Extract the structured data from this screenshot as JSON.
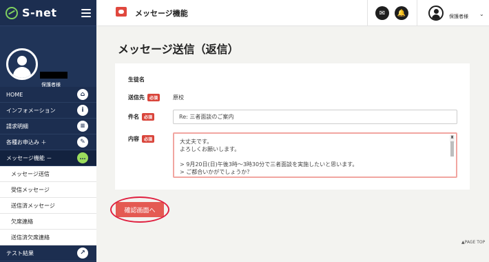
{
  "app": {
    "logo": "S-net"
  },
  "profile": {
    "name": "保護者様"
  },
  "nav": {
    "items": [
      {
        "label": "HOME",
        "icon": "home-icon",
        "glyph": "⌂"
      },
      {
        "label": "インフォメーション",
        "icon": "info-icon",
        "glyph": "i"
      },
      {
        "label": "請求明細",
        "icon": "document-icon",
        "glyph": "≡"
      },
      {
        "label": "各種お申込み ＋",
        "icon": "edit-icon",
        "glyph": "✎"
      },
      {
        "label": "メッセージ機能 －",
        "icon": "chat-icon",
        "glyph": "…"
      }
    ],
    "sub_items": [
      "メッセージ送信",
      "受信メッセージ",
      "送信済メッセージ",
      "欠席連絡",
      "送信済欠席連絡"
    ],
    "last_item": {
      "label": "テスト結果",
      "icon": "chart-icon",
      "glyph": "↗"
    }
  },
  "header": {
    "title": "メッセージ機能",
    "mail_glyph": "✉",
    "bell_glyph": "🔔",
    "user": "保護者様",
    "caret": "⌄"
  },
  "page": {
    "title": "メッセージ送信（返信）"
  },
  "form": {
    "student_label": "生徒名",
    "to_label": "送信先",
    "to_value": "原校",
    "subject_label": "件名",
    "subject_value": "Re: 三者面談のご案内",
    "content_label": "内容",
    "required_badge": "必須",
    "content_lines": [
      "大丈夫です。",
      "よろしくお願いします。",
      "",
      "> 9月20日(日)午後3時～3時30分で三者面談を実施したいと思います。",
      "> ご都合いかがでしょうか？"
    ]
  },
  "actions": {
    "confirm": "確認画面へ"
  },
  "footer": {
    "page_top": "▲PAGE TOP"
  },
  "colors": {
    "sidebar": "#1c2e50",
    "accent_red": "#e45a52",
    "active_green": "#9bdc5c"
  }
}
